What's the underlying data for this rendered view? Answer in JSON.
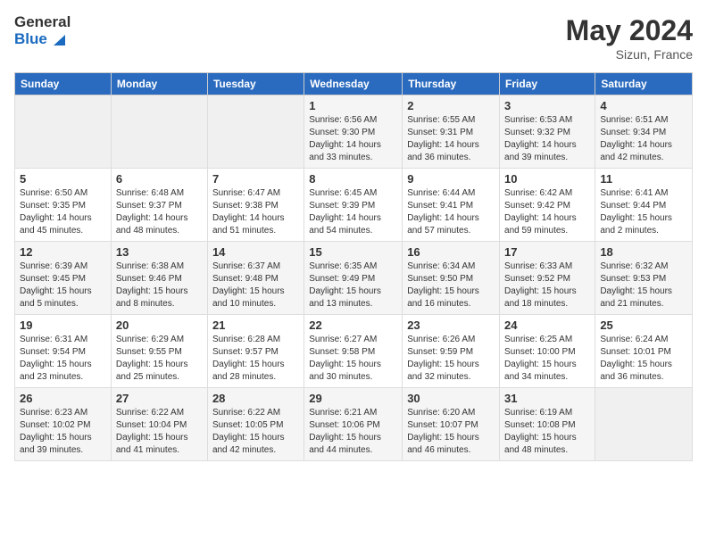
{
  "header": {
    "logo_general": "General",
    "logo_blue": "Blue",
    "month_year": "May 2024",
    "location": "Sizun, France"
  },
  "weekdays": [
    "Sunday",
    "Monday",
    "Tuesday",
    "Wednesday",
    "Thursday",
    "Friday",
    "Saturday"
  ],
  "weeks": [
    [
      {
        "day": "",
        "sunrise": "",
        "sunset": "",
        "daylight": ""
      },
      {
        "day": "",
        "sunrise": "",
        "sunset": "",
        "daylight": ""
      },
      {
        "day": "",
        "sunrise": "",
        "sunset": "",
        "daylight": ""
      },
      {
        "day": "1",
        "sunrise": "Sunrise: 6:56 AM",
        "sunset": "Sunset: 9:30 PM",
        "daylight": "Daylight: 14 hours and 33 minutes."
      },
      {
        "day": "2",
        "sunrise": "Sunrise: 6:55 AM",
        "sunset": "Sunset: 9:31 PM",
        "daylight": "Daylight: 14 hours and 36 minutes."
      },
      {
        "day": "3",
        "sunrise": "Sunrise: 6:53 AM",
        "sunset": "Sunset: 9:32 PM",
        "daylight": "Daylight: 14 hours and 39 minutes."
      },
      {
        "day": "4",
        "sunrise": "Sunrise: 6:51 AM",
        "sunset": "Sunset: 9:34 PM",
        "daylight": "Daylight: 14 hours and 42 minutes."
      }
    ],
    [
      {
        "day": "5",
        "sunrise": "Sunrise: 6:50 AM",
        "sunset": "Sunset: 9:35 PM",
        "daylight": "Daylight: 14 hours and 45 minutes."
      },
      {
        "day": "6",
        "sunrise": "Sunrise: 6:48 AM",
        "sunset": "Sunset: 9:37 PM",
        "daylight": "Daylight: 14 hours and 48 minutes."
      },
      {
        "day": "7",
        "sunrise": "Sunrise: 6:47 AM",
        "sunset": "Sunset: 9:38 PM",
        "daylight": "Daylight: 14 hours and 51 minutes."
      },
      {
        "day": "8",
        "sunrise": "Sunrise: 6:45 AM",
        "sunset": "Sunset: 9:39 PM",
        "daylight": "Daylight: 14 hours and 54 minutes."
      },
      {
        "day": "9",
        "sunrise": "Sunrise: 6:44 AM",
        "sunset": "Sunset: 9:41 PM",
        "daylight": "Daylight: 14 hours and 57 minutes."
      },
      {
        "day": "10",
        "sunrise": "Sunrise: 6:42 AM",
        "sunset": "Sunset: 9:42 PM",
        "daylight": "Daylight: 14 hours and 59 minutes."
      },
      {
        "day": "11",
        "sunrise": "Sunrise: 6:41 AM",
        "sunset": "Sunset: 9:44 PM",
        "daylight": "Daylight: 15 hours and 2 minutes."
      }
    ],
    [
      {
        "day": "12",
        "sunrise": "Sunrise: 6:39 AM",
        "sunset": "Sunset: 9:45 PM",
        "daylight": "Daylight: 15 hours and 5 minutes."
      },
      {
        "day": "13",
        "sunrise": "Sunrise: 6:38 AM",
        "sunset": "Sunset: 9:46 PM",
        "daylight": "Daylight: 15 hours and 8 minutes."
      },
      {
        "day": "14",
        "sunrise": "Sunrise: 6:37 AM",
        "sunset": "Sunset: 9:48 PM",
        "daylight": "Daylight: 15 hours and 10 minutes."
      },
      {
        "day": "15",
        "sunrise": "Sunrise: 6:35 AM",
        "sunset": "Sunset: 9:49 PM",
        "daylight": "Daylight: 15 hours and 13 minutes."
      },
      {
        "day": "16",
        "sunrise": "Sunrise: 6:34 AM",
        "sunset": "Sunset: 9:50 PM",
        "daylight": "Daylight: 15 hours and 16 minutes."
      },
      {
        "day": "17",
        "sunrise": "Sunrise: 6:33 AM",
        "sunset": "Sunset: 9:52 PM",
        "daylight": "Daylight: 15 hours and 18 minutes."
      },
      {
        "day": "18",
        "sunrise": "Sunrise: 6:32 AM",
        "sunset": "Sunset: 9:53 PM",
        "daylight": "Daylight: 15 hours and 21 minutes."
      }
    ],
    [
      {
        "day": "19",
        "sunrise": "Sunrise: 6:31 AM",
        "sunset": "Sunset: 9:54 PM",
        "daylight": "Daylight: 15 hours and 23 minutes."
      },
      {
        "day": "20",
        "sunrise": "Sunrise: 6:29 AM",
        "sunset": "Sunset: 9:55 PM",
        "daylight": "Daylight: 15 hours and 25 minutes."
      },
      {
        "day": "21",
        "sunrise": "Sunrise: 6:28 AM",
        "sunset": "Sunset: 9:57 PM",
        "daylight": "Daylight: 15 hours and 28 minutes."
      },
      {
        "day": "22",
        "sunrise": "Sunrise: 6:27 AM",
        "sunset": "Sunset: 9:58 PM",
        "daylight": "Daylight: 15 hours and 30 minutes."
      },
      {
        "day": "23",
        "sunrise": "Sunrise: 6:26 AM",
        "sunset": "Sunset: 9:59 PM",
        "daylight": "Daylight: 15 hours and 32 minutes."
      },
      {
        "day": "24",
        "sunrise": "Sunrise: 6:25 AM",
        "sunset": "Sunset: 10:00 PM",
        "daylight": "Daylight: 15 hours and 34 minutes."
      },
      {
        "day": "25",
        "sunrise": "Sunrise: 6:24 AM",
        "sunset": "Sunset: 10:01 PM",
        "daylight": "Daylight: 15 hours and 36 minutes."
      }
    ],
    [
      {
        "day": "26",
        "sunrise": "Sunrise: 6:23 AM",
        "sunset": "Sunset: 10:02 PM",
        "daylight": "Daylight: 15 hours and 39 minutes."
      },
      {
        "day": "27",
        "sunrise": "Sunrise: 6:22 AM",
        "sunset": "Sunset: 10:04 PM",
        "daylight": "Daylight: 15 hours and 41 minutes."
      },
      {
        "day": "28",
        "sunrise": "Sunrise: 6:22 AM",
        "sunset": "Sunset: 10:05 PM",
        "daylight": "Daylight: 15 hours and 42 minutes."
      },
      {
        "day": "29",
        "sunrise": "Sunrise: 6:21 AM",
        "sunset": "Sunset: 10:06 PM",
        "daylight": "Daylight: 15 hours and 44 minutes."
      },
      {
        "day": "30",
        "sunrise": "Sunrise: 6:20 AM",
        "sunset": "Sunset: 10:07 PM",
        "daylight": "Daylight: 15 hours and 46 minutes."
      },
      {
        "day": "31",
        "sunrise": "Sunrise: 6:19 AM",
        "sunset": "Sunset: 10:08 PM",
        "daylight": "Daylight: 15 hours and 48 minutes."
      },
      {
        "day": "",
        "sunrise": "",
        "sunset": "",
        "daylight": ""
      }
    ]
  ]
}
